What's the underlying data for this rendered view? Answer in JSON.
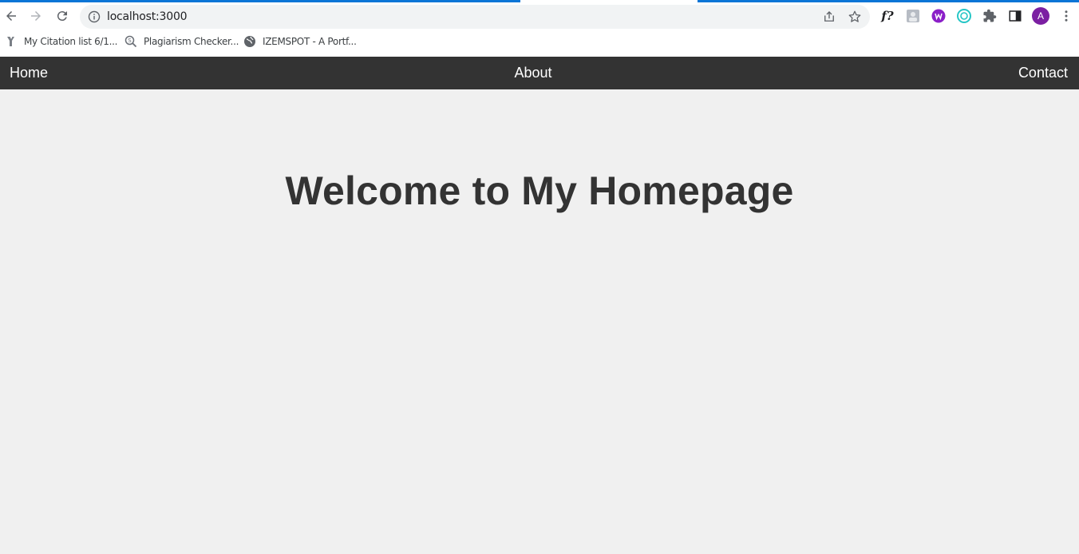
{
  "browser": {
    "url": "localhost:3000",
    "accent_color": "#0b75d6",
    "profile_initial": "A",
    "profile_color": "#7b1fa2",
    "bookmarks": [
      {
        "label": "My Citation list 6/1...",
        "icon": "citation-icon"
      },
      {
        "label": "Plagiarism Checker...",
        "icon": "plagiarism-icon"
      },
      {
        "label": "IZEMSPOT - A Portf...",
        "icon": "globe-icon"
      }
    ],
    "extension_text": "f?"
  },
  "navbar": {
    "background": "#333333",
    "items": [
      {
        "label": "Home"
      },
      {
        "label": "About"
      },
      {
        "label": "Contact"
      }
    ]
  },
  "hero": {
    "title": "Welcome to My Homepage"
  }
}
